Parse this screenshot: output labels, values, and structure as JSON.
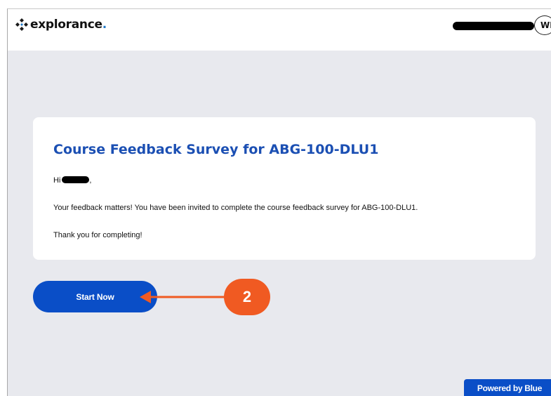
{
  "header": {
    "logo_text": "explorance",
    "logo_dot": ".",
    "avatar_initials": "WH"
  },
  "survey": {
    "title": "Course Feedback Survey for ABG-100-DLU1",
    "greeting_prefix": "Hi",
    "greeting_suffix": ",",
    "body_line_1": "Your feedback matters! You have been invited to complete the course feedback survey for ABG-100-DLU1.",
    "body_line_2": "Thank you for completing!"
  },
  "actions": {
    "start_label": "Start Now"
  },
  "callout": {
    "number": "2",
    "color": "#f05a22"
  },
  "footer": {
    "powered_label": "Powered by Blue"
  },
  "colors": {
    "brand_blue": "#0a4ec7",
    "title_blue": "#1b4fb3",
    "page_background": "#e8e9ee"
  }
}
